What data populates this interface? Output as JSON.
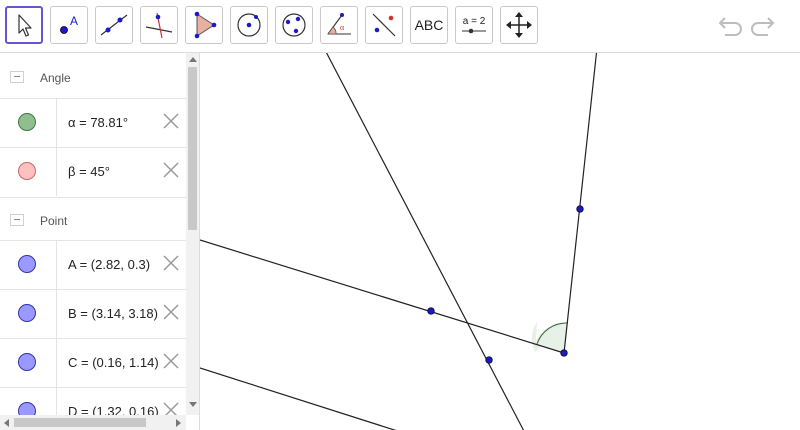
{
  "toolbar": {
    "tools": [
      {
        "name": "move-tool",
        "icon": "pointer-arrow-icon",
        "active": true
      },
      {
        "name": "point-tool",
        "icon": "point-a-icon"
      },
      {
        "name": "line-tool",
        "icon": "line-through-two-points-icon"
      },
      {
        "name": "perpendicular-line-tool",
        "icon": "perpendicular-line-icon"
      },
      {
        "name": "polygon-tool",
        "icon": "polygon-icon"
      },
      {
        "name": "circle-tool",
        "icon": "circle-center-point-icon"
      },
      {
        "name": "circle-three-points-tool",
        "icon": "circle-three-points-icon"
      },
      {
        "name": "angle-tool",
        "icon": "angle-icon"
      },
      {
        "name": "reflect-tool",
        "icon": "reflect-about-line-icon"
      },
      {
        "name": "text-tool",
        "icon": "text-icon",
        "label": "ABC"
      },
      {
        "name": "slider-tool",
        "icon": "slider-icon",
        "label": "a = 2"
      },
      {
        "name": "move-graphics-tool",
        "icon": "move-graphics-view-icon"
      }
    ],
    "undo_icon": "undo-icon",
    "redo_icon": "redo-icon"
  },
  "algebra": {
    "groups": [
      {
        "label": "Angle"
      },
      {
        "label": "Point"
      }
    ],
    "angle_items": [
      {
        "definition": "α = 78.81°",
        "color": "#8fbf8f"
      },
      {
        "definition": "β = 45°",
        "color": "#ffc0c0"
      }
    ],
    "point_items": [
      {
        "definition": "A = (2.82, 0.3)",
        "color": "#9999ff"
      },
      {
        "definition": "B = (3.14, 3.18)",
        "color": "#9999ff"
      },
      {
        "definition": "C = (0.16, 1.14)",
        "color": "#9999ff"
      },
      {
        "definition": "D = (1.32, 0.16)",
        "color": "#9999ff"
      }
    ]
  },
  "colors": {
    "point": "#1a1acc",
    "line": "#222222",
    "angle_fill": "#e6f0e6",
    "angle_stroke": "#336633",
    "active_tool_border": "#6557d2"
  }
}
